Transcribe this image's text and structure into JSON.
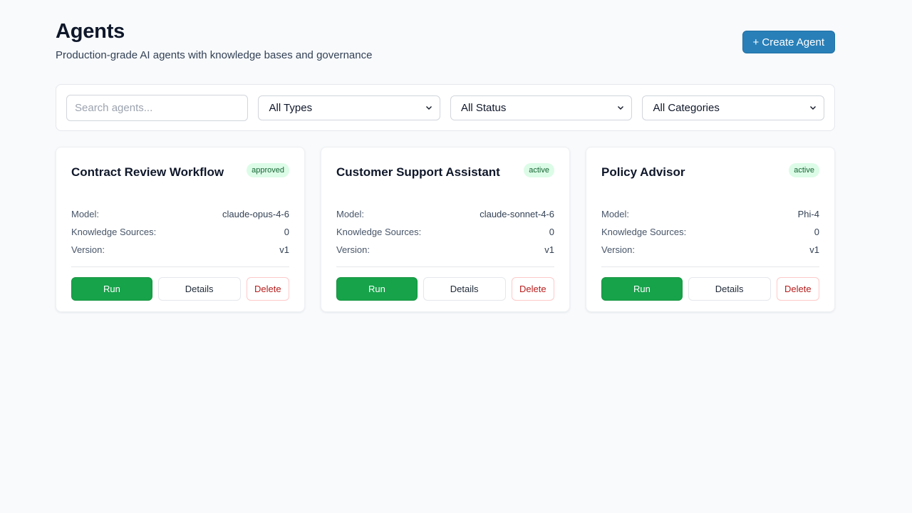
{
  "header": {
    "title": "Agents",
    "subtitle": "Production-grade AI agents with knowledge bases and governance",
    "create_button_label": "+ Create Agent"
  },
  "filters": {
    "search_placeholder": "Search agents...",
    "search_value": "",
    "type_select": "All Types",
    "status_select": "All Status",
    "category_select": "All Categories"
  },
  "labels": {
    "model": "Model:",
    "knowledge_sources": "Knowledge Sources:",
    "version": "Version:",
    "run": "Run",
    "details": "Details",
    "delete": "Delete"
  },
  "agents": [
    {
      "name": "Contract Review Workflow",
      "status": "approved",
      "model": "claude-opus-4-6",
      "knowledge_sources": "0",
      "version": "v1"
    },
    {
      "name": "Customer Support Assistant",
      "status": "active",
      "model": "claude-sonnet-4-6",
      "knowledge_sources": "0",
      "version": "v1"
    },
    {
      "name": "Policy Advisor",
      "status": "active",
      "model": "Phi-4",
      "knowledge_sources": "0",
      "version": "v1"
    }
  ],
  "colors": {
    "primary": "#2980b9",
    "run": "#16a34a",
    "delete_text": "#b91c1c",
    "badge_bg": "#dcfce7",
    "badge_text": "#166534",
    "background": "#f8fafc"
  },
  "icons": {
    "select_chevron": "chevron-down-icon"
  }
}
